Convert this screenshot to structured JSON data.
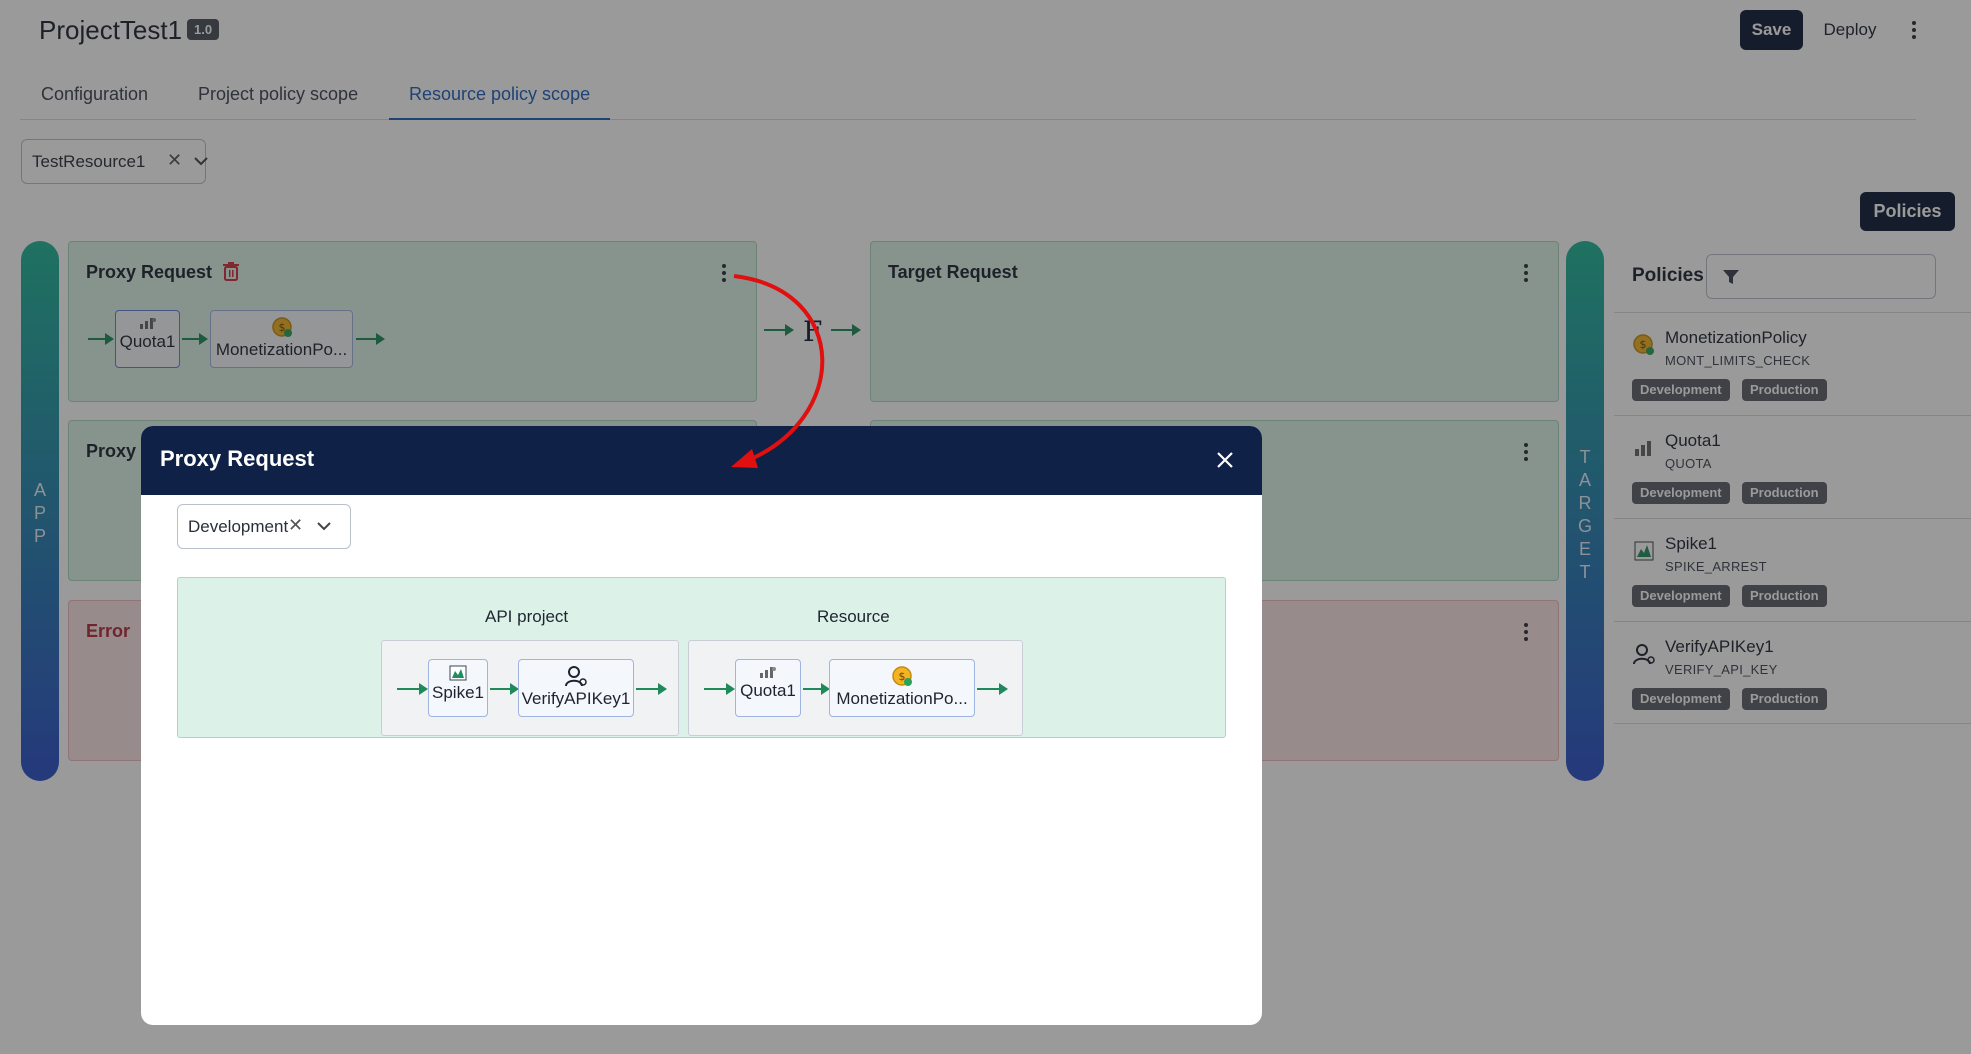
{
  "header": {
    "title": "ProjectTest1",
    "version": "1.0",
    "save_label": "Save",
    "deploy_label": "Deploy"
  },
  "tabs": [
    {
      "label": "Configuration",
      "active": false
    },
    {
      "label": "Project policy scope",
      "active": false
    },
    {
      "label": "Resource policy scope",
      "active": true
    }
  ],
  "resource_select": {
    "value": "TestResource1"
  },
  "policies_button_label": "Policies",
  "rails": {
    "left": "APP",
    "right": "TARGET"
  },
  "flows": {
    "proxy_request": {
      "title": "Proxy Request",
      "chips": [
        "Quota1",
        "MonetizationPo..."
      ]
    },
    "target_request": {
      "title": "Target Request"
    },
    "proxy_response": {
      "title": "Proxy"
    },
    "error": {
      "title": "Error"
    },
    "connector_glyph": "F"
  },
  "sidebar": {
    "title": "Policies",
    "items": [
      {
        "name": "MonetizationPolicy",
        "type": "MONT_LIMITS_CHECK",
        "icon": "monetization-icon",
        "envs": [
          "Development",
          "Production"
        ]
      },
      {
        "name": "Quota1",
        "type": "QUOTA",
        "icon": "quota-icon",
        "envs": [
          "Development",
          "Production"
        ]
      },
      {
        "name": "Spike1",
        "type": "SPIKE_ARREST",
        "icon": "spike-icon",
        "envs": [
          "Development",
          "Production"
        ]
      },
      {
        "name": "VerifyAPIKey1",
        "type": "VERIFY_API_KEY",
        "icon": "verify-key-icon",
        "envs": [
          "Development",
          "Production"
        ]
      }
    ]
  },
  "modal": {
    "title": "Proxy Request",
    "env_select": {
      "value": "Development"
    },
    "sections": {
      "api_project": {
        "label": "API project",
        "chips": [
          "Spike1",
          "VerifyAPIKey1"
        ]
      },
      "resource": {
        "label": "Resource",
        "chips": [
          "Quota1",
          "MonetizationPo..."
        ]
      }
    }
  },
  "colors": {
    "navy": "#0e1a35",
    "modal_header": "#0f2146",
    "flow_green": "#1e8a5a",
    "active_tab": "#1f5fbf",
    "annotation_red": "#e01010"
  }
}
